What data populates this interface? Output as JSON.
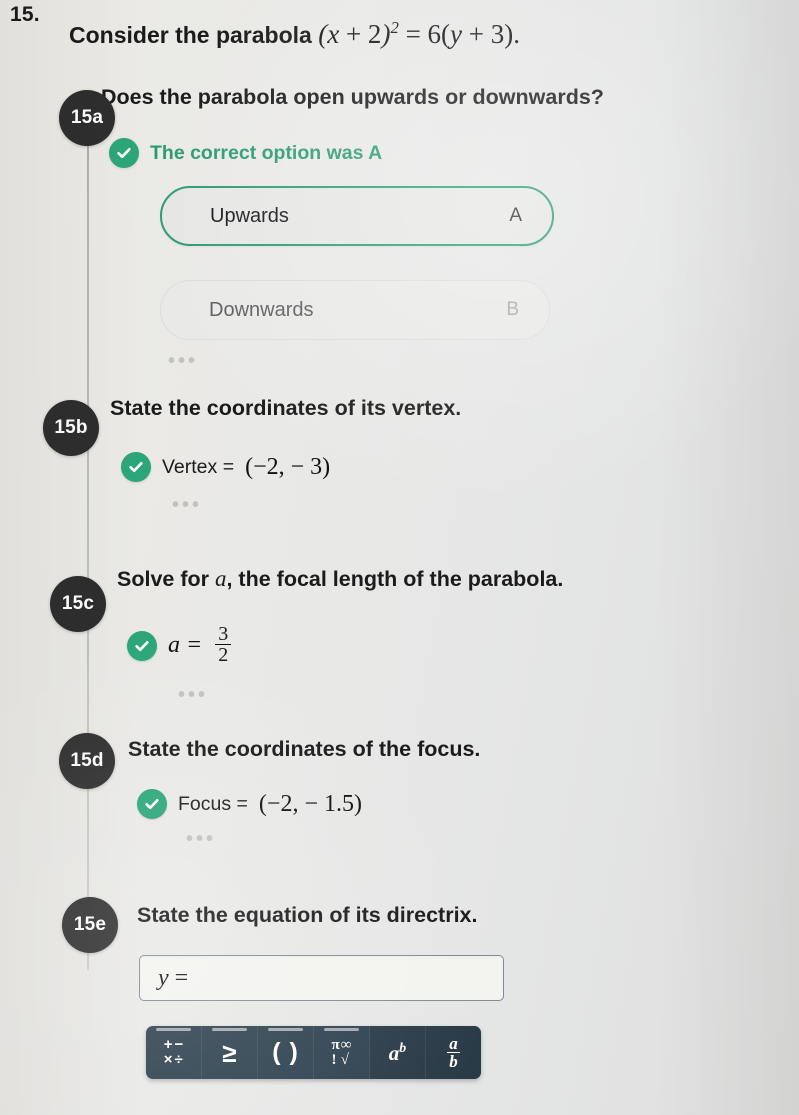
{
  "question": {
    "number": "15.",
    "stem_text": "Consider the parabola",
    "stem_equation": "(x + 2)² = 6(y + 3).",
    "equation_parts": {
      "open_paren": "(",
      "var_x": "x",
      "plus_two": " + 2",
      "close_paren": ")",
      "exponent": "2",
      "equals": " = 6(",
      "var_y": "y",
      "plus_three": " + 3",
      "close_paren2": ").",
      "paren_x_plus_2": "(x + 2)",
      "tail": " = 6(y + 3)."
    }
  },
  "colors": {
    "badge_bg": "#2e2e2e",
    "correct_green": "#2a9a71",
    "tick_green": "#2ca678",
    "pill_border_correct": "#2a9d72",
    "keypad_bg": "#2f4250",
    "input_border": "#7f8d99",
    "page_bg": "#e9e9e6"
  },
  "parts": [
    {
      "id": "15a",
      "badge": "15a",
      "prompt": "Does the parabola open upwards or downwards?",
      "feedback": "The correct option was A",
      "feedback_icon": "check-circle-icon",
      "options": [
        {
          "label": "Upwards",
          "key": "A",
          "state": "correct"
        },
        {
          "label": "Downwards",
          "key": "B",
          "state": "normal"
        }
      ],
      "overflow": "•••"
    },
    {
      "id": "15b",
      "badge": "15b",
      "prompt": "State the coordinates of its vertex.",
      "answer_label": "Vertex =",
      "answer_value": "(−2,  − 3)",
      "answer_icon": "check-circle-icon",
      "overflow": "•••"
    },
    {
      "id": "15c",
      "badge": "15c",
      "prompt_before": "Solve for",
      "prompt_var": "a",
      "prompt_after": ", the focal length of the parabola.",
      "answer_label": "a =",
      "answer_numerator": "3",
      "answer_denominator": "2",
      "answer_icon": "check-circle-icon",
      "overflow": "•••"
    },
    {
      "id": "15d",
      "badge": "15d",
      "prompt": "State the coordinates of the focus.",
      "answer_label": "Focus =",
      "answer_value": "(−2,  − 1.5)",
      "answer_icon": "check-circle-icon",
      "overflow": "•••"
    },
    {
      "id": "15e",
      "badge": "15e",
      "prompt": "State the equation of its directrix.",
      "input_prefix_var": "y",
      "input_prefix_eq": " =",
      "input_value": ""
    }
  ],
  "keypad": {
    "keys": [
      {
        "name": "operators-key",
        "glyphs": [
          "+",
          "−",
          "×",
          "÷"
        ],
        "type": "ops"
      },
      {
        "name": "inequality-key",
        "glyph": "≥",
        "type": "geq"
      },
      {
        "name": "parentheses-key",
        "glyph": "( )",
        "type": "paren"
      },
      {
        "name": "constants-key",
        "glyphs": [
          "π",
          "∞",
          "!",
          "√"
        ],
        "type": "mix"
      },
      {
        "name": "exponent-key",
        "base": "a",
        "exp": "b",
        "type": "pow"
      },
      {
        "name": "fraction-key",
        "num": "a",
        "den": "b",
        "type": "frac"
      }
    ]
  }
}
